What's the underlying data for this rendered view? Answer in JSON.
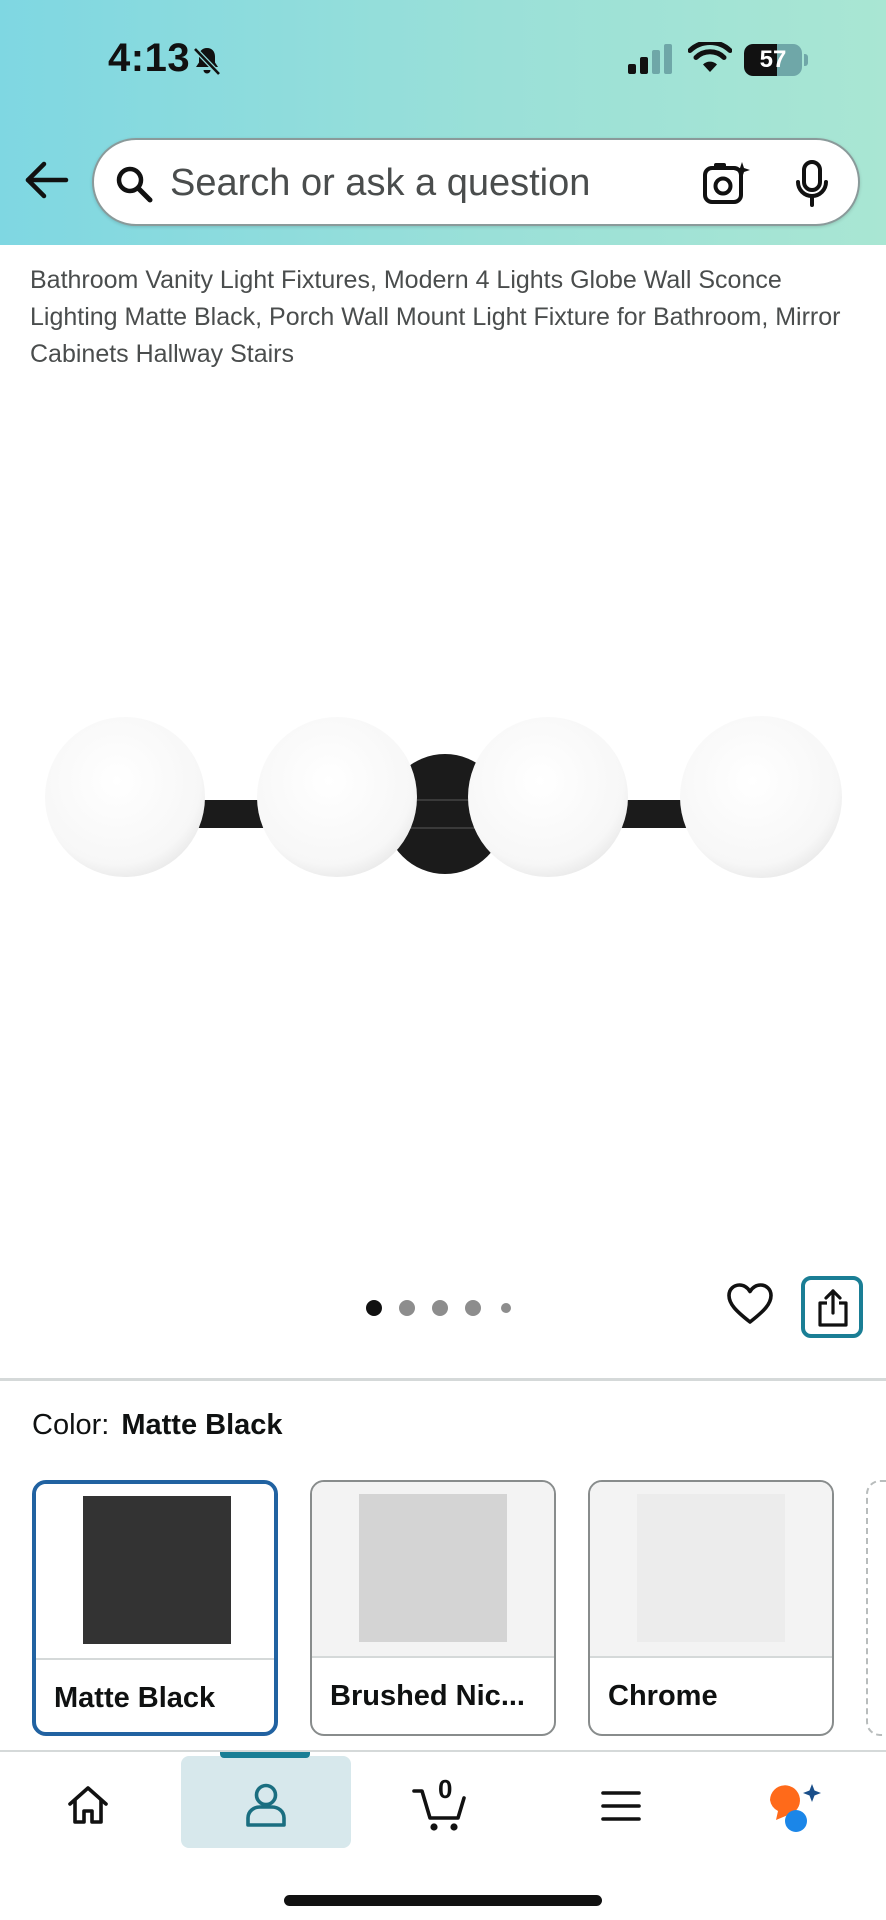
{
  "status_bar": {
    "time": "4:13",
    "battery_level": "57",
    "battery_fraction": 0.57
  },
  "search": {
    "placeholder": "Search or ask a question"
  },
  "product": {
    "title": "Bathroom Vanity Light Fixtures, Modern 4 Lights Globe Wall Sconce Lighting Matte Black, Porch Wall Mount Light Fixture for Bathroom, Mirror Cabinets Hallway Stairs",
    "image_count": 5,
    "active_image_index": 0
  },
  "color_selector": {
    "label": "Color:",
    "selected_value": "Matte Black",
    "options": [
      {
        "label": "Matte Black",
        "selected": true,
        "swatch_color": "#333333"
      },
      {
        "label": "Brushed Nic...",
        "selected": false,
        "swatch_color": "#d4d4d4"
      },
      {
        "label": "Chrome",
        "selected": false,
        "swatch_color": "#ececec"
      }
    ]
  },
  "bottom_nav": {
    "items": [
      {
        "name": "home",
        "icon": "home-icon",
        "active": false
      },
      {
        "name": "account",
        "icon": "person-icon",
        "active": true
      },
      {
        "name": "cart",
        "icon": "cart-icon",
        "active": false,
        "count": "0"
      },
      {
        "name": "menu",
        "icon": "hamburger-menu-icon",
        "active": false
      },
      {
        "name": "rufus",
        "icon": "rufus-assistant-icon",
        "active": false
      }
    ]
  },
  "colors": {
    "header_gradient_start": "#7fd7e2",
    "header_gradient_end": "#a9e6d3",
    "accent_teal": "#1a7e95",
    "selected_border_blue": "#2162a1",
    "product_black": "#1b1b1b"
  }
}
